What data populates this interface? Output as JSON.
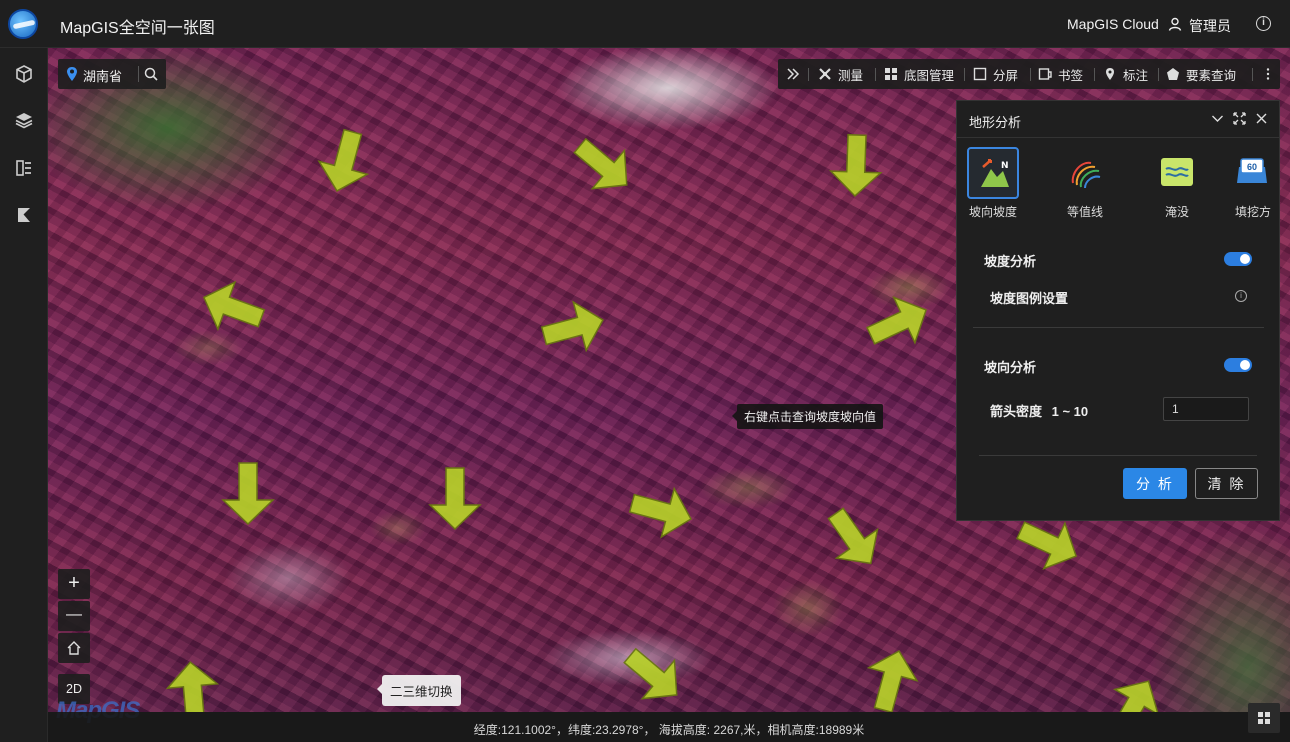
{
  "header": {
    "app_title": "MapGIS全空间一张图",
    "cloud_label": "MapGIS Cloud",
    "user_name": "管理员"
  },
  "sidebar": {
    "items": [
      {
        "icon": "cube-icon"
      },
      {
        "icon": "layers-icon"
      },
      {
        "icon": "list-icon"
      },
      {
        "icon": "k-logo-icon"
      }
    ]
  },
  "search": {
    "region": "湖南省"
  },
  "toolbar": {
    "items": [
      {
        "label": "测量",
        "icon": "measure-icon"
      },
      {
        "label": "底图管理",
        "icon": "basemap-icon"
      },
      {
        "label": "分屏",
        "icon": "split-screen-icon"
      },
      {
        "label": "书签",
        "icon": "bookmark-icon"
      },
      {
        "label": "标注",
        "icon": "marker-icon"
      },
      {
        "label": "要素查询",
        "icon": "feature-query-icon"
      }
    ]
  },
  "panel": {
    "title": "地形分析",
    "tools": [
      {
        "label": "坡向坡度",
        "active": true
      },
      {
        "label": "等值线",
        "active": false
      },
      {
        "label": "淹没",
        "active": false
      },
      {
        "label": "填挖方",
        "active": false
      }
    ],
    "slope_label": "坡度分析",
    "slope_enabled": true,
    "slope_legend_label": "坡度图例设置",
    "aspect_label": "坡向分析",
    "aspect_enabled": true,
    "arrow_density_label": "箭头密度",
    "arrow_density_range": "1 ~ 10",
    "arrow_density_value": "1",
    "analyze_button": "分 析",
    "clear_button": "清 除",
    "fill_badge": "60"
  },
  "map": {
    "tooltip": "右键点击查询坡度坡向值",
    "switch_tip": "二三维切换",
    "zoom_in": "+",
    "zoom_out": "—",
    "mode_button": "2D",
    "watermark": "MapGIS",
    "colors": {
      "arrow": "#b7d12a",
      "terrain": "#7b2e5e",
      "accent": "#2b87e6"
    }
  },
  "status": {
    "text": "经度:121.1002°，纬度:23.2978°， 海拔高度: 2267,米，相机高度:18989米"
  }
}
